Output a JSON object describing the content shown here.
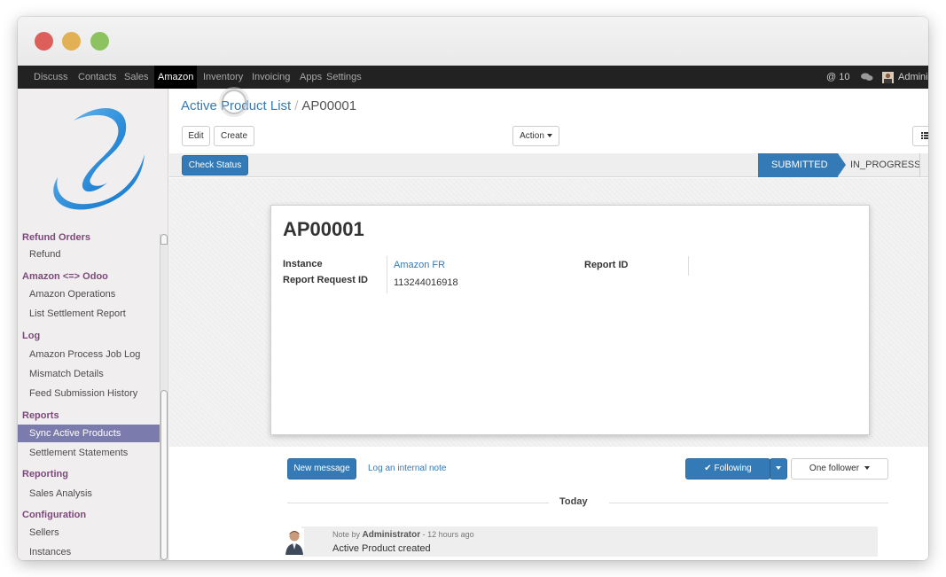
{
  "window": {
    "controls": [
      "close",
      "minimize",
      "maximize"
    ]
  },
  "topnav": {
    "items": [
      "Discuss",
      "Contacts",
      "Sales",
      "Amazon",
      "Inventory",
      "Invoicing",
      "Apps",
      "Settings"
    ],
    "active": "Amazon",
    "notifications_label": "@ 10",
    "chat_icon": "chat-bubbles-icon",
    "user_label": "Admini"
  },
  "sidebar": {
    "sections": {
      "refund_orders": "Refund Orders",
      "amazon_odoo": "Amazon <=> Odoo",
      "log": "Log",
      "reports": "Reports",
      "reporting": "Reporting",
      "configuration": "Configuration"
    },
    "items": {
      "refund": "Refund",
      "amazon_operations": "Amazon Operations",
      "list_settlement_report": "List Settlement Report",
      "amazon_process_job_log": "Amazon Process Job Log",
      "mismatch_details": "Mismatch Details",
      "feed_submission_history": "Feed Submission History",
      "sync_active_products": "Sync Active Products",
      "settlement_statements": "Settlement Statements",
      "sales_analysis": "Sales Analysis",
      "sellers": "Sellers",
      "instances": "Instances"
    },
    "selected": "Sync Active Products"
  },
  "breadcrumb": {
    "parent": "Active Product List",
    "separator": "/",
    "current": "AP00001"
  },
  "buttons": {
    "edit": "Edit",
    "create": "Create",
    "action": "Action",
    "check_status": "Check Status",
    "list_view_icon": "list-icon"
  },
  "statusbar": {
    "stages": [
      "SUBMITTED",
      "IN_PROGRESS"
    ],
    "current": "SUBMITTED"
  },
  "record": {
    "name": "AP00001",
    "fields": {
      "instance_label": "Instance",
      "instance_value": "Amazon FR",
      "report_request_id_label": "Report Request ID",
      "report_request_id_value": "113244016918",
      "report_id_label": "Report ID",
      "report_id_value": ""
    }
  },
  "chatter": {
    "new_message": "New message",
    "log_note": "Log an internal note",
    "following": "✔ Following",
    "followers": "One follower",
    "date_separator": "Today",
    "message": {
      "prefix": "Note by",
      "author": "Administrator",
      "time": "- 12 hours ago",
      "body": "Active Product created"
    }
  },
  "colors": {
    "primary": "#337ab7",
    "menu_header": "#7c4a7a",
    "menu_selected": "#7c7bad",
    "topbar": "#222222"
  }
}
